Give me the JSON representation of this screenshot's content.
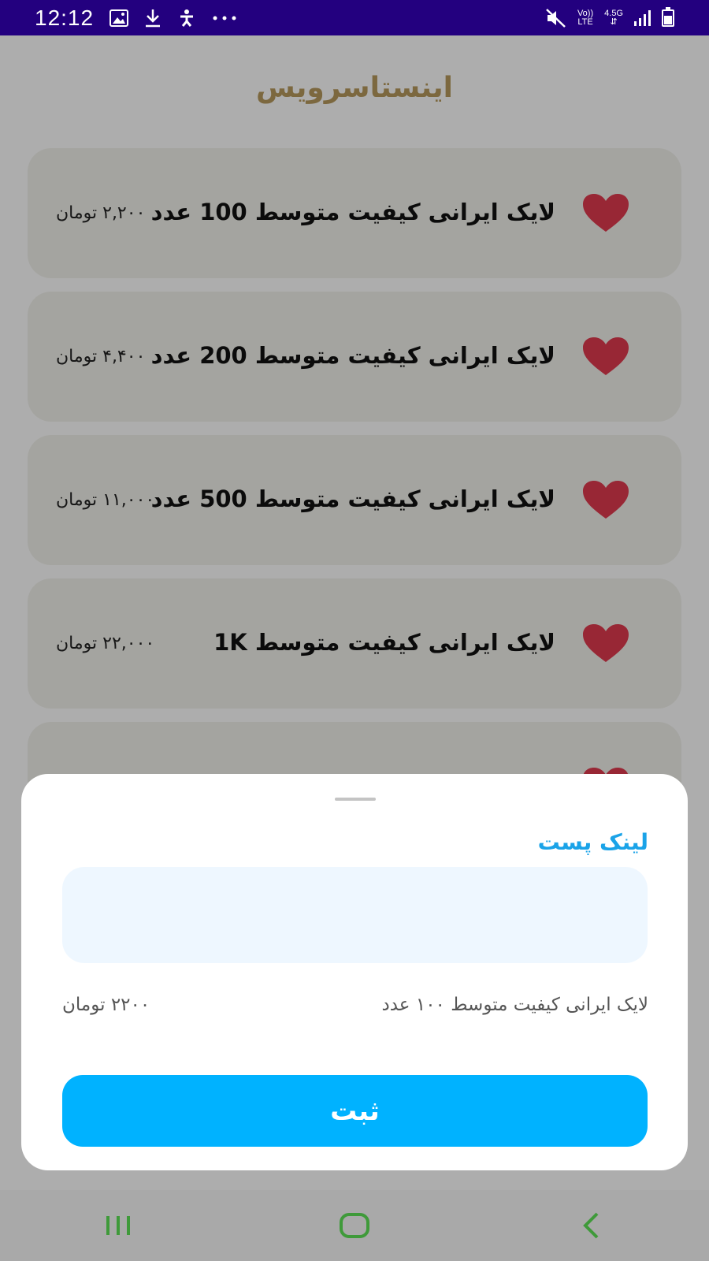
{
  "status_bar": {
    "time": "12:12",
    "network_top": "Vo))",
    "network_bottom": "LTE",
    "data_type": "4.5G",
    "left_icons": [
      "gallery-icon",
      "download-icon",
      "accessibility-icon",
      "more-dots-icon"
    ],
    "right_icons": [
      "mute-icon",
      "signal-icon",
      "battery-icon"
    ]
  },
  "header": {
    "title": "اینستاسرویس"
  },
  "services": [
    {
      "title": "لایک ایرانی کیفیت متوسط 100 عدد",
      "price": "۲,۲۰۰ تومان",
      "icon": "heart-icon"
    },
    {
      "title": "لایک ایرانی کیفیت متوسط 200 عدد",
      "price": "۴,۴۰۰ تومان",
      "icon": "heart-icon"
    },
    {
      "title": "لایک ایرانی کیفیت متوسط 500 عدد",
      "price": "۱۱,۰۰۰ تومان",
      "icon": "heart-icon"
    },
    {
      "title": "لایک ایرانی کیفیت متوسط 1K",
      "price": "۲۲,۰۰۰ تومان",
      "icon": "heart-icon"
    }
  ],
  "sheet": {
    "label": "لینک پست",
    "input_value": "",
    "input_placeholder": "",
    "selected_service": "لایک ایرانی کیفیت متوسط ۱۰۰ عدد",
    "selected_price": "۲۲۰۰ تومان",
    "submit_label": "ثبت"
  },
  "colors": {
    "status_bar": "#23007f",
    "title": "#b79a5d",
    "card": "#f2f2ec",
    "heart": "#e03a4e",
    "accent": "#1aa3e8",
    "button": "#00b2ff",
    "input_bg": "#eef7ff",
    "nav_icons": "#3f9a3a"
  },
  "nav_bar": {
    "icons": [
      "recent-apps-icon",
      "home-icon",
      "back-icon"
    ]
  }
}
